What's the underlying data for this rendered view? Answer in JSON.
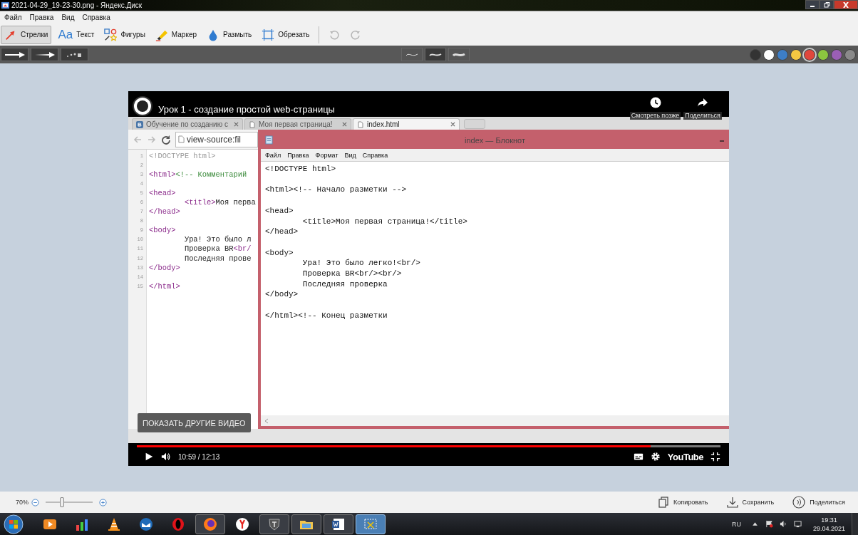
{
  "window": {
    "title": "2021-04-29_19-23-30.png - Яндекс.Диск"
  },
  "menu": [
    "Файл",
    "Правка",
    "Вид",
    "Справка"
  ],
  "tools": [
    {
      "kind": "arrow",
      "label": "Стрелки",
      "selected": true
    },
    {
      "kind": "text",
      "glyph": "Aa",
      "label": "Текст",
      "selected": false
    },
    {
      "kind": "shapes",
      "label": "Фигуры",
      "selected": false
    },
    {
      "kind": "marker",
      "label": "Маркер",
      "selected": false
    },
    {
      "kind": "blur",
      "label": "Размыть",
      "selected": false
    },
    {
      "kind": "crop",
      "label": "Обрезать",
      "selected": false
    }
  ],
  "history": [
    {
      "kind": "undo",
      "disabled": true
    },
    {
      "kind": "redo",
      "disabled": true
    }
  ],
  "arrow_styles": [
    {
      "kind": "straight"
    },
    {
      "kind": "tapered"
    },
    {
      "kind": "dotted"
    }
  ],
  "thickness": [
    {
      "selected": false
    },
    {
      "selected": true
    },
    {
      "selected": false
    }
  ],
  "colors": [
    {
      "color": "#333333",
      "selected": false
    },
    {
      "color": "#ffffff",
      "selected": false
    },
    {
      "color": "#3d7ec7",
      "selected": false
    },
    {
      "color": "#f5c842",
      "selected": false
    },
    {
      "color": "#e0473c",
      "selected": true
    },
    {
      "color": "#8cc63f",
      "selected": false
    },
    {
      "color": "#9b5fb5",
      "selected": false
    },
    {
      "color": "#8a8a8a",
      "selected": false
    }
  ],
  "video": {
    "title": "Урок 1 - создание простой web-страницы",
    "watch_later": "Смотреть позже",
    "share": "Поделиться",
    "browser": {
      "tabs": [
        {
          "label": "Обучение по созданию с",
          "kind": "vk",
          "selected": false
        },
        {
          "label": "Моя первая страница!",
          "kind": "page",
          "selected": false
        },
        {
          "label": "index.html",
          "kind": "page",
          "selected": true
        }
      ],
      "address": "view-source:fil",
      "source_lines": [
        {
          "number": "1",
          "segments": [
            {
              "text": "<!DOCTYPE html>",
              "kind": "doctype"
            }
          ]
        },
        {
          "number": "2"
        },
        {
          "number": "3",
          "segments": [
            {
              "text": "<html>",
              "kind": "tag"
            },
            {
              "text": "<!-- Комментарий",
              "kind": "comment"
            }
          ]
        },
        {
          "number": "4"
        },
        {
          "number": "5",
          "segments": [
            {
              "text": "<head>",
              "kind": "tag"
            }
          ]
        },
        {
          "number": "6",
          "segments": [
            {
              "text": "\t<title>",
              "kind": "tag"
            },
            {
              "text": "Моя перва",
              "kind": "text"
            }
          ]
        },
        {
          "number": "7",
          "segments": [
            {
              "text": "</head>",
              "kind": "tag"
            }
          ]
        },
        {
          "number": "8"
        },
        {
          "number": "9",
          "segments": [
            {
              "text": "<body>",
              "kind": "tag"
            }
          ]
        },
        {
          "number": "10",
          "segments": [
            {
              "text": "\tУра! Это было л",
              "kind": "text"
            }
          ]
        },
        {
          "number": "11",
          "segments": [
            {
              "text": "\tПроверка BR",
              "kind": "text"
            },
            {
              "text": "<br/",
              "kind": "tag"
            }
          ]
        },
        {
          "number": "12",
          "segments": [
            {
              "text": "\tПоследняя прове",
              "kind": "text"
            }
          ]
        },
        {
          "number": "13",
          "segments": [
            {
              "text": "</body>",
              "kind": "tag"
            }
          ]
        },
        {
          "number": "14"
        },
        {
          "number": "15",
          "segments": [
            {
              "text": "</html>",
              "kind": "tag"
            }
          ]
        }
      ]
    },
    "notepad": {
      "title": "index — Блокнот",
      "menu": [
        "Файл",
        "Правка",
        "Формат",
        "Вид",
        "Справка"
      ],
      "text": "<!DOCTYPE html>\n\n<html><!-- Начало разметки -->\n\n<head>\n\t<title>Моя первая страница!</title>\n</head>\n\n<body>\n\tУра! Это было легко!<br/>\n\tПроверка BR<br/><br/>\n\tПоследняя проверка\n</body>\n\n</html><!-- Конец разметки"
    },
    "more_videos": "ПОКАЗАТЬ ДРУГИЕ ВИДЕО",
    "player": {
      "level": 0.88,
      "time": "10:59 / 12:13",
      "logo": "YouTube"
    }
  },
  "zoom": {
    "reading": "70%",
    "level": 0.35
  },
  "actions": [
    {
      "kind": "copy",
      "label": "Копировать"
    },
    {
      "kind": "save",
      "label": "Сохранить"
    },
    {
      "kind": "share",
      "label": "Поделиться"
    }
  ],
  "taskbar": {
    "apps": [
      {
        "kind": "media",
        "running": false,
        "selected": false
      },
      {
        "kind": "chart",
        "running": false,
        "selected": false
      },
      {
        "kind": "cone",
        "running": false,
        "selected": false
      },
      {
        "kind": "mail",
        "running": false,
        "selected": false
      },
      {
        "kind": "opera",
        "running": false,
        "selected": false
      },
      {
        "kind": "firefox",
        "running": true,
        "selected": false
      },
      {
        "kind": "yandex",
        "running": false,
        "selected": false
      },
      {
        "kind": "tank",
        "running": true,
        "selected": false
      },
      {
        "kind": "folder",
        "running": true,
        "selected": false
      },
      {
        "kind": "word",
        "running": true,
        "selected": false
      },
      {
        "kind": "screenshot",
        "running": true,
        "selected": true
      }
    ],
    "lang": "RU",
    "time": "19:31",
    "date": "29.04.2021"
  }
}
